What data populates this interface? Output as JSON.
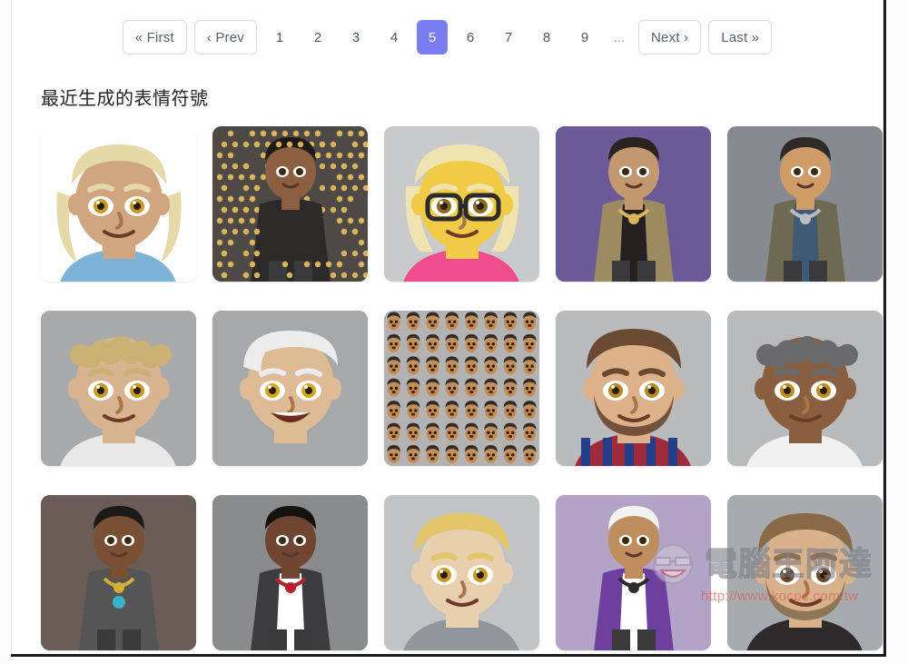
{
  "pagination": {
    "first_label": "« First",
    "prev_label": "‹ Prev",
    "next_label": "Next ›",
    "last_label": "Last »",
    "ellipsis": "...",
    "active_page": "5",
    "active_color": "#7b7ef0",
    "pages": [
      "1",
      "2",
      "3",
      "4",
      "5",
      "6",
      "7",
      "8",
      "9"
    ]
  },
  "section": {
    "title": "最近生成的表情符號"
  },
  "gallery": {
    "items": [
      {
        "name": "blond-wavy-hair-girl-emoji",
        "bg": "#ffffff",
        "kind": "face",
        "skin": "#cfa680",
        "hair": "#e6d9a8",
        "hair_style": "wavy-long",
        "eye": "#c89a20",
        "shirt": "#7db3d8"
      },
      {
        "name": "dreadlocks-man-gold-dots-emoji",
        "bg": "#4f4946",
        "kind": "figure-dots",
        "skin": "#8d5f42",
        "hair": "#1d1a19",
        "dots": "#d8b45c",
        "shirt": "#2c2a29"
      },
      {
        "name": "blond-glasses-woman-yellow-emoji",
        "bg": "#c9cacb",
        "kind": "face",
        "skin": "#f2cb46",
        "hair": "#efe4b0",
        "hair_style": "bob",
        "eye": "#8a6a20",
        "glasses": "#2b2b2b",
        "shirt": "#ef4d8e"
      },
      {
        "name": "bearded-man-hoodie-purple-emoji",
        "bg": "#6b5a97",
        "kind": "figure",
        "skin": "#c2986f",
        "hair": "#2b2320",
        "jacket": "#9c8a61",
        "shirt": "#23201f",
        "accent": "#d8b45c"
      },
      {
        "name": "boy-with-blaster-gray-emoji",
        "bg": "#868a91",
        "kind": "figure",
        "skin": "#cf9c67",
        "hair": "#2e2a28",
        "jacket": "#6e6a52",
        "shirt": "#3f5a74",
        "accent": "#b9bcc2"
      },
      {
        "name": "curly-blond-man-gray-emoji",
        "bg": "#a9aaab",
        "kind": "face",
        "skin": "#d7b48f",
        "hair": "#cbb173",
        "hair_style": "curly",
        "eye": "#c89a20",
        "shirt": "#e9e9ea"
      },
      {
        "name": "white-hair-smiling-man-emoji",
        "bg": "#a7a8a9",
        "kind": "face",
        "skin": "#ddbb94",
        "hair": "#ececec",
        "hair_style": "swoop",
        "eye": "#d6a81f",
        "smile": true
      },
      {
        "name": "repeated-faces-grid-emoji",
        "bg": "#b3b3b3",
        "kind": "face-tile-grid",
        "skin": "#c58e56",
        "hair": "#332b26",
        "rows": 7,
        "cols": 8
      },
      {
        "name": "bearded-footballer-man-emoji",
        "bg": "#b9bbbd",
        "kind": "face",
        "skin": "#ddb189",
        "hair": "#6a4a33",
        "hair_style": "short",
        "eye": "#b8891e",
        "beard": "#6a4a33",
        "shirt": "#9f2b3f",
        "shirt2": "#243e87"
      },
      {
        "name": "gray-hair-man-white-tee-emoji",
        "bg": "#b8babc",
        "kind": "face",
        "skin": "#8a5f3f",
        "hair": "#6a6a6c",
        "hair_style": "curly",
        "eye": "#c08c1c",
        "shirt": "#f0f0f0"
      },
      {
        "name": "pharaoh-tutankhamun-emoji",
        "bg": "#6b5c58",
        "kind": "figure",
        "skin": "#7a5034",
        "hair": "#1c1a19",
        "accent": "#d4af37",
        "jewel": "#39b3c4"
      },
      {
        "name": "man-in-suit-with-cigar-emoji",
        "bg": "#8a8b8d",
        "kind": "figure",
        "skin": "#6f4631",
        "hair": "#15120f",
        "jacket": "#3c3c3e",
        "shirt": "#ffffff",
        "accent": "#b4202e"
      },
      {
        "name": "blond-young-man-gray-emoji",
        "bg": "#c2c3c5",
        "kind": "face",
        "skin": "#e8cfae",
        "hair": "#e4c66a",
        "hair_style": "short",
        "eye": "#c89a20",
        "shirt": "#90969c"
      },
      {
        "name": "elderly-man-purple-vest-emoji",
        "bg": "#b3a3c6",
        "kind": "figure",
        "skin": "#c08e5e",
        "hair": "#f2f2f2",
        "jacket": "#6e3f9e",
        "shirt": "#ffffff",
        "accent": "#2c2c2e"
      },
      {
        "name": "bearded-man-gray-gradient-emoji",
        "bg": "#a8abad",
        "kind": "face",
        "skin": "#d7b28c",
        "hair": "#8a6a46",
        "hair_style": "short",
        "eye": "#6a4a2a",
        "beard": "#8a7053",
        "shirt": "#2e2a2b"
      }
    ]
  },
  "watermark": {
    "text": "電腦王阿達",
    "url": "http://www.kocpc.com.tw"
  }
}
